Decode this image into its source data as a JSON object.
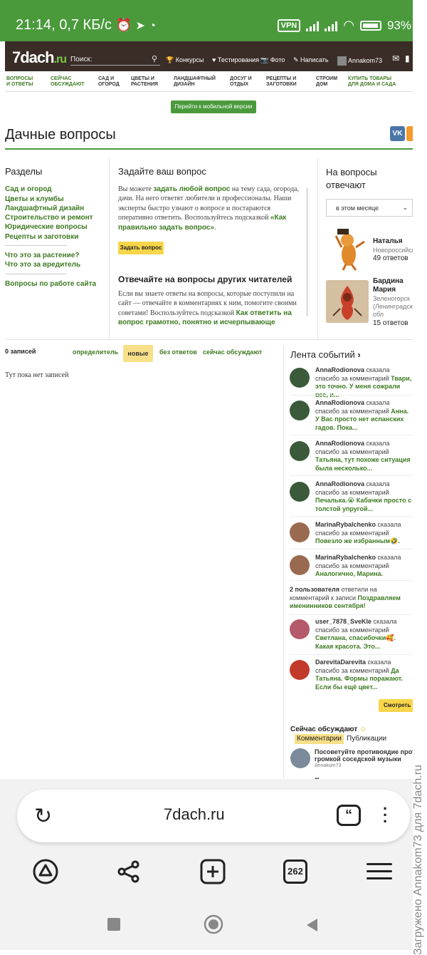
{
  "status": {
    "time": "21:14",
    "speed": "0,7 КБ/с",
    "vpn": "VPN",
    "battery": "93%"
  },
  "site": {
    "logo_main": "7dach",
    "logo_tld": ".ru",
    "search_placeholder": "Поиск:",
    "header_nav": [
      "Конкурсы",
      "Тестирования",
      "Фото",
      "Написать",
      "Annakom73"
    ]
  },
  "categories": [
    {
      "line1": "ВОПРОСЫ",
      "line2": "И ОТВЕТЫ"
    },
    {
      "line1": "СЕЙЧАС",
      "line2": "ОБСУЖДАЮТ"
    },
    {
      "line1": "САД И",
      "line2": "ОГОРОД"
    },
    {
      "line1": "ЦВЕТЫ И",
      "line2": "РАСТЕНИЯ"
    },
    {
      "line1": "ЛАНДШАФТНЫЙ",
      "line2": "ДИЗАЙН"
    },
    {
      "line1": "ДОСУГ И",
      "line2": "ОТДЫХ"
    },
    {
      "line1": "РЕЦЕПТЫ И",
      "line2": "ЗАГОТОВКИ"
    },
    {
      "line1": "СТРОИМ",
      "line2": "ДОМ"
    },
    {
      "line1": "КУПИТЬ ТОВАРЫ",
      "line2": "ДЛЯ ДОМА И САДА"
    }
  ],
  "mobile_button": "Перейти к мобильной версии",
  "page_title": "Дачные вопросы",
  "social": {
    "vk": "VK"
  },
  "sections": {
    "title": "Разделы",
    "links": [
      "Сад и огород",
      "Цветы и клумбы",
      "Ландшафтный дизайн",
      "Строительство и ремонт",
      "Юридические вопросы",
      "Рецепты и заготовки"
    ],
    "links2": [
      "Что это за растение?",
      "Что это за вредитель"
    ],
    "links3": [
      "Вопросы по работе сайта"
    ],
    "divider": "-----------------------------"
  },
  "ask": {
    "title": "Задайте ваш вопрос",
    "p_1": "Вы можете ",
    "p_link1": "задать любой вопрос",
    "p_2": " на тему сада, огорода, дачи. На него ответят любители и профессионалы. Наши эксперты быстро узнают о вопросе и постараются оперативно ответить. Воспользуйтесь подсказкой ",
    "p_link2": "«Как правильно задать вопрос»",
    "p_3": ".",
    "button": "Задать вопрос"
  },
  "answer": {
    "title": "Отвечайте на вопросы других читателей",
    "p_1": "Если вы знаете ответы на вопросы, которые поступили на сайт — отвечайте в комментариях к ним, помогите своими советами! Воспользуйтесь подсказкой ",
    "p_link": "Как ответить на вопрос грамотно, понятно и исчерпывающе"
  },
  "experts": {
    "title_1": "На вопросы",
    "title_2": "отвечают",
    "period": "в этом месяце",
    "list": [
      {
        "name": "Наталья",
        "city": "Новороссийск",
        "count": "49 ответов"
      },
      {
        "name_1": "Бардина",
        "name_2": "Мария",
        "city_1": "Зеленогорск",
        "city_2": "(Ленинградская",
        "city_3": "обл",
        "count": "15 ответов"
      }
    ]
  },
  "records": {
    "count": "0 записей",
    "filters": [
      "определитель",
      "новые",
      "без ответов",
      "сейчас обсуждают"
    ],
    "empty": "Тут пока нет записей"
  },
  "feed": {
    "title": "Лента событий",
    "said": "сказала спасибо за комментарий",
    "items": [
      {
        "user": "AnnaRodionova",
        "text": "Твари, это точно. У меня сожрали все, и..."
      },
      {
        "user": "AnnaRodionova",
        "text": "Анна. У Вас просто нет испанских гадов. Пока..."
      },
      {
        "user": "AnnaRodionova",
        "text": "Татьяна, тут похоже ситуация была несколько..."
      },
      {
        "user": "AnnaRodionova",
        "text": "Печалька.😭 Кабачки просто с толстой упругой..."
      },
      {
        "user": "MarinaRybalchenko",
        "text": "Повезло же избранным🤣."
      },
      {
        "user": "MarinaRybalchenko",
        "text": "Аналогично, Марина."
      }
    ],
    "group_1": "2 пользователя",
    "group_2": " ответили на комментарий к записи ",
    "group_link": "Поздравляем именинников сентября!",
    "items2": [
      {
        "user": "user_7878_SveKle",
        "text": "Светлана, спасибочки🥰. Какая красота. Это..."
      },
      {
        "user": "DarevitaDarevita",
        "text": "Да Татьяна. Формы поражают. Если бы ещё цвет..."
      }
    ],
    "watch_all": "Смотреть все",
    "discuss_title": "Сейчас обсуждают",
    "tab_comments": "Комментарии",
    "tab_publications": "Публикации",
    "topic1_1": "Посоветуйте противоядие против",
    "topic1_2": "громкой соседской музыки",
    "topic1_author": "Annakom73",
    "topic2": "Поздравляем именинников"
  },
  "watermark": "Загружено Annakom73 для 7dach.ru",
  "browser": {
    "url": "7dach.ru",
    "tabs": "262"
  }
}
